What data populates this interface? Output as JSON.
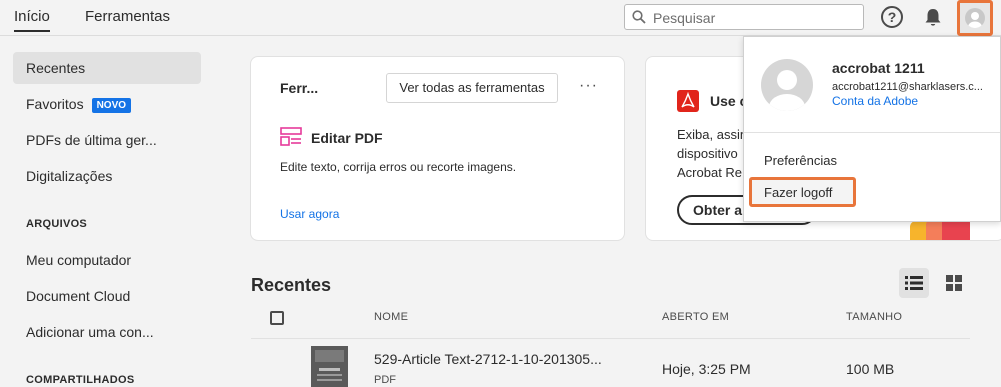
{
  "topbar": {
    "tabs": [
      {
        "label": "Início",
        "active": true
      },
      {
        "label": "Ferramentas",
        "active": false
      }
    ],
    "search_placeholder": "Pesquisar",
    "help_glyph": "?"
  },
  "sidebar": {
    "items": [
      {
        "label": "Recentes",
        "active": true
      },
      {
        "label": "Favoritos",
        "badge": "NOVO"
      },
      {
        "label": "PDFs de última ger..."
      },
      {
        "label": "Digitalizações"
      }
    ],
    "arquivos_heading": "ARQUIVOS",
    "arquivos_items": [
      {
        "label": "Meu computador"
      },
      {
        "label": "Document Cloud"
      },
      {
        "label": "Adicionar uma con..."
      }
    ],
    "compartilhados_heading": "COMPARTILHADOS"
  },
  "tools_card": {
    "title": "Ferr...",
    "view_all": "Ver todas as ferramentas",
    "more": "···",
    "tool_name": "Editar PDF",
    "tool_desc": "Edite texto, corrija erros ou recorte imagens.",
    "use_now": "Usar agora"
  },
  "promo_card": {
    "title": "Use c",
    "desc_lines": [
      "Exiba, assin",
      "dispositivo",
      "Acrobat Re"
    ],
    "button": "Obter a"
  },
  "recent": {
    "title": "Recentes",
    "columns": [
      "NOME",
      "ABERTO EM",
      "TAMANHO"
    ],
    "rows": [
      {
        "name": "529-Article Text-2712-1-10-201305...",
        "type": "PDF",
        "opened": "Hoje, 3:25 PM",
        "size": "100 MB"
      }
    ]
  },
  "account_menu": {
    "name": "accrobat 1211",
    "email": "accrobat1211@sharklasers.c...",
    "adobe_link": "Conta da Adobe",
    "preferences": "Preferências",
    "logoff": "Fazer logoff"
  },
  "colors": {
    "accent": "#1473e6",
    "highlight": "#e8753b",
    "pdf_red": "#e1251b",
    "tool_pink": "#e63a9a"
  }
}
